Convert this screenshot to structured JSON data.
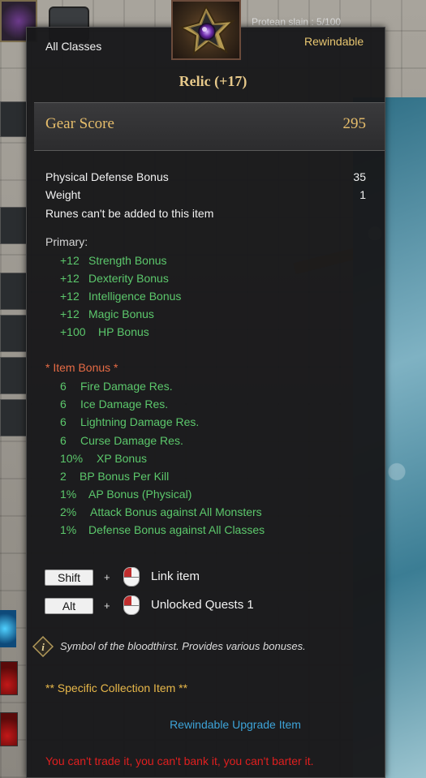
{
  "background": {
    "quest_tracker_text": "Protean slain : 5/100"
  },
  "tooltip": {
    "class_requirement": "All Classes",
    "rewindable_tag": "Rewindable",
    "item_name": "Relic (+17)",
    "gear_score_label": "Gear Score",
    "gear_score_value": "295",
    "stats": [
      {
        "label": "Physical Defense Bonus",
        "value": "35"
      },
      {
        "label": "Weight",
        "value": "1"
      },
      {
        "label": "Runes can't be added to this item",
        "value": ""
      }
    ],
    "primary_heading": "Primary:",
    "primary": [
      {
        "value": "+12",
        "name": "Strength Bonus"
      },
      {
        "value": "+12",
        "name": "Dexterity Bonus"
      },
      {
        "value": "+12",
        "name": "Intelligence Bonus"
      },
      {
        "value": "+12",
        "name": "Magic Bonus"
      },
      {
        "value": "+100",
        "name": "HP Bonus"
      }
    ],
    "item_bonus_heading": "*  Item Bonus *",
    "item_bonus": [
      {
        "value": "6",
        "name": "Fire Damage Res."
      },
      {
        "value": "6",
        "name": "Ice Damage Res."
      },
      {
        "value": "6",
        "name": "Lightning Damage Res."
      },
      {
        "value": "6",
        "name": "Curse Damage Res."
      },
      {
        "value": "10%",
        "name": "XP Bonus"
      },
      {
        "value": "2",
        "name": "BP Bonus Per Kill"
      },
      {
        "value": "1%",
        "name": "AP Bonus (Physical)"
      },
      {
        "value": "2%",
        "name": "Attack Bonus against All Monsters"
      },
      {
        "value": "1%",
        "name": "Defense Bonus against All Classes"
      }
    ],
    "shortcuts": [
      {
        "key": "Shift",
        "plus": "+",
        "action": "Link item"
      },
      {
        "key": "Alt",
        "plus": "+",
        "action": "Unlocked Quests 1"
      }
    ],
    "description": "Symbol of the bloodthirst. Provides various bonuses.",
    "collection_text": "** Specific Collection Item **",
    "upgrade_text": "Rewindable Upgrade Item",
    "warning_text": "You can't trade it, you can't bank it, you can't barter it.",
    "colors": {
      "gold": "#e6bd6b",
      "green": "#5cc86c",
      "red": "#e01f1f",
      "blue": "#3da3d8",
      "orange": "#e66b45"
    },
    "icons": {
      "item": "relic-emblem-icon",
      "info": "info-icon",
      "mouse": "mouse-left-click-icon"
    }
  }
}
